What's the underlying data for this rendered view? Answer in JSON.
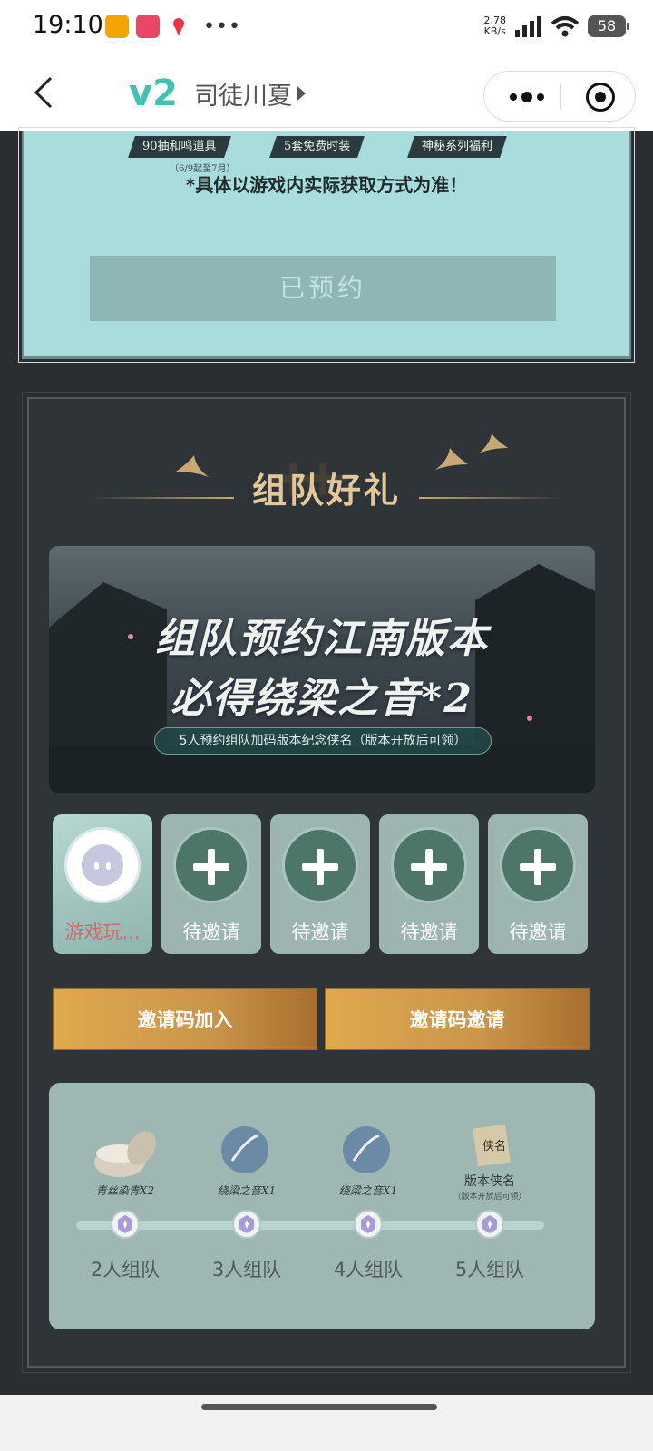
{
  "status_bar": {
    "time": "19:10",
    "net_speed_value": "2.78",
    "net_speed_unit": "KB/s",
    "battery": "58",
    "app_icons": [
      "weibo-icon",
      "app-icon",
      "maps-icon"
    ]
  },
  "title_bar": {
    "logo_text": "v2",
    "title": "司徒川夏"
  },
  "top_panel": {
    "rewards": [
      "90抽和鸣道具",
      "5套免费时装",
      "神秘系列福利"
    ],
    "reward_sub": "（6/9起至7月）",
    "note": "*具体以游戏内实际获取方式为准！",
    "reserved_button": "已预约"
  },
  "team": {
    "title": "组队好礼",
    "banner": {
      "line1": "组队预约江南版本",
      "line2": "必得绕梁之音*2",
      "subtitle": "5人预约组队加码版本纪念侠名（版本开放后可领）"
    },
    "slots": [
      {
        "label": "游戏玩...",
        "type": "me"
      },
      {
        "label": "待邀请",
        "type": "invite"
      },
      {
        "label": "待邀请",
        "type": "invite"
      },
      {
        "label": "待邀请",
        "type": "invite"
      },
      {
        "label": "待邀请",
        "type": "invite"
      }
    ],
    "join_button": "邀请码加入",
    "invite_button": "邀请码邀请",
    "progress": [
      {
        "reward": "青丝染青X2",
        "sub": "",
        "label": "2人组队"
      },
      {
        "reward": "绕梁之音X1",
        "sub": "",
        "label": "3人组队"
      },
      {
        "reward": "绕梁之音X1",
        "sub": "",
        "label": "4人组队"
      },
      {
        "reward": "版本侠名",
        "sub": "（版本开放后可领）",
        "label": "5人组队"
      }
    ],
    "scroll_badge": "侠名"
  },
  "colors": {
    "accent_gold": "#e0a94d",
    "panel_teal": "#a9dcdc",
    "dark_bg": "#2f3438"
  }
}
